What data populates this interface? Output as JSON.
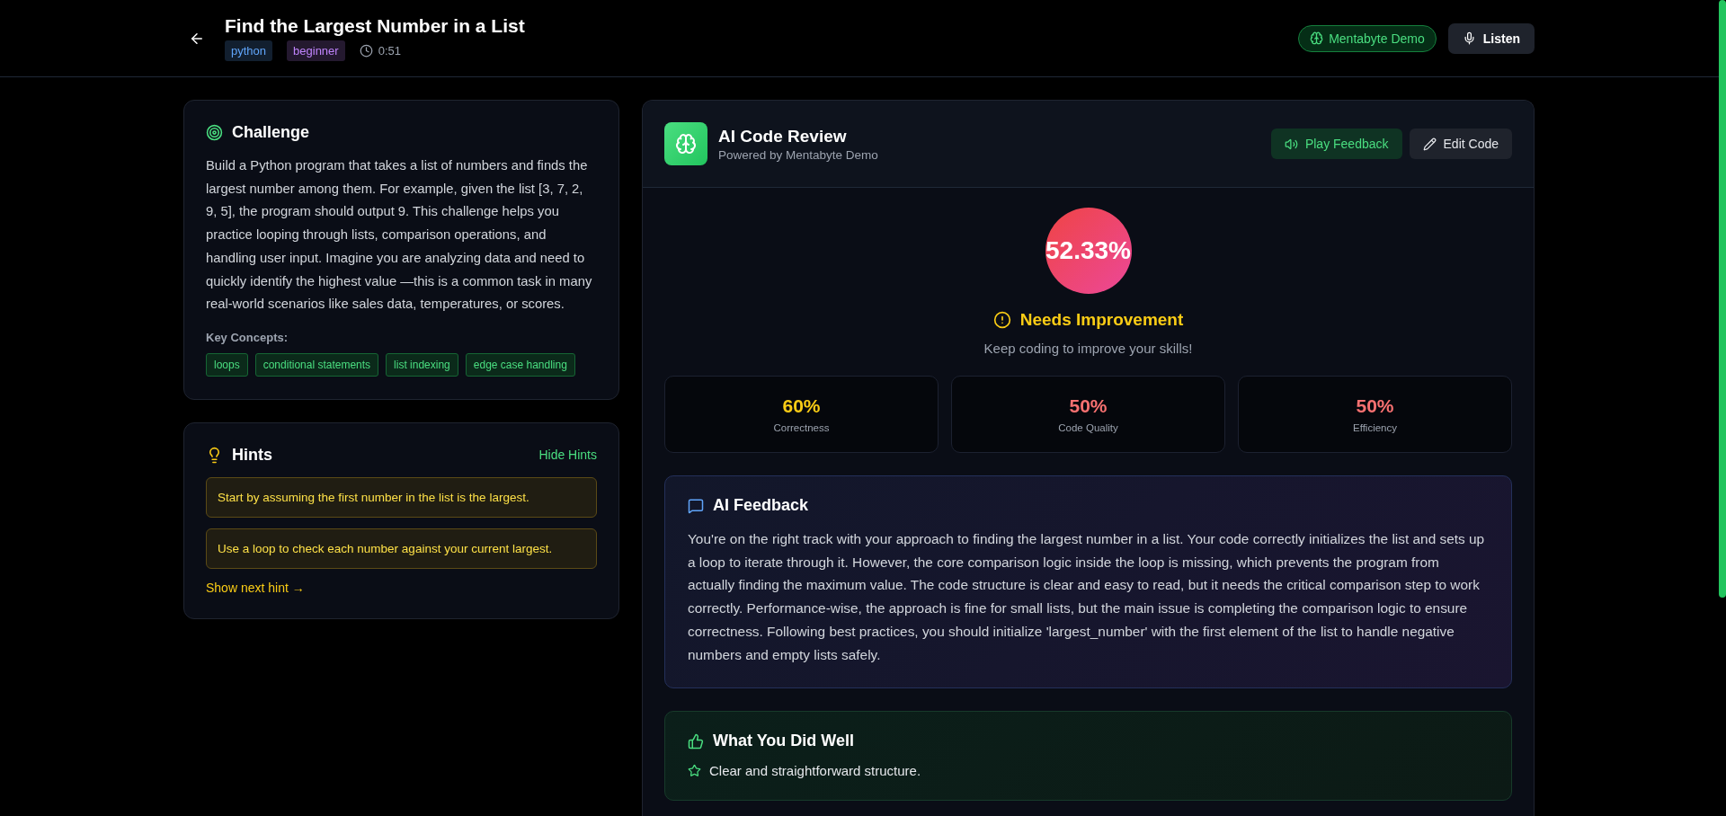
{
  "header": {
    "title": "Find the Largest Number in a List",
    "tags": [
      {
        "label": "python",
        "kind": "language"
      },
      {
        "label": "beginner",
        "kind": "level"
      }
    ],
    "timer": "0:51",
    "brand_badge": "Mentabyte Demo",
    "listen_button": "Listen"
  },
  "challenge": {
    "title": "Challenge",
    "description": "Build a Python program that takes a list of numbers and finds the largest number among them. For example, given the list [3, 7, 2, 9, 5], the program should output 9. This challenge helps you practice looping through lists, comparison operations, and handling user input. Imagine you are analyzing data and need to quickly identify the highest value —this is a common task in many real-world scenarios like sales data, temperatures, or scores.",
    "concepts_label": "Key Concepts:",
    "concepts": [
      "loops",
      "conditional statements",
      "list indexing",
      "edge case handling"
    ]
  },
  "hints": {
    "title": "Hints",
    "toggle": "Hide Hints",
    "items": [
      "Start by assuming the first number in the list is the largest.",
      "Use a loop to check each number against your current largest."
    ],
    "next_hint": "Show next hint →"
  },
  "review": {
    "title": "AI Code Review",
    "subtitle": "Powered by Mentabyte Demo",
    "buttons": [
      {
        "label": "Play Feedback",
        "kind": "play"
      },
      {
        "label": "Edit Code",
        "kind": "edit"
      }
    ],
    "score": "52.33%",
    "verdict": "Needs Improvement",
    "verdict_note": "Keep coding to improve your skills!",
    "metrics": [
      {
        "value": "60%",
        "label": "Correctness",
        "color": "#facc15"
      },
      {
        "value": "50%",
        "label": "Code Quality",
        "color": "#f87171"
      },
      {
        "value": "50%",
        "label": "Efficiency",
        "color": "#f87171"
      }
    ],
    "feedback": {
      "title": "AI Feedback",
      "text": "You're on the right track with your approach to finding the largest number in a list. Your code correctly initializes the list and sets up a loop to iterate through it. However, the core comparison logic inside the loop is missing, which prevents the program from actually finding the maximum value. The code structure is clear and easy to read, but it needs the critical comparison step to work correctly. Performance-wise, the approach is fine for small lists, but the main issue is completing the comparison logic to ensure correctness. Following best practices, you should initialize 'largest_number' with the first element of the list to handle negative numbers and empty lists safely."
    },
    "strengths": {
      "title": "What You Did Well",
      "items": [
        "Clear and straightforward structure."
      ]
    }
  }
}
